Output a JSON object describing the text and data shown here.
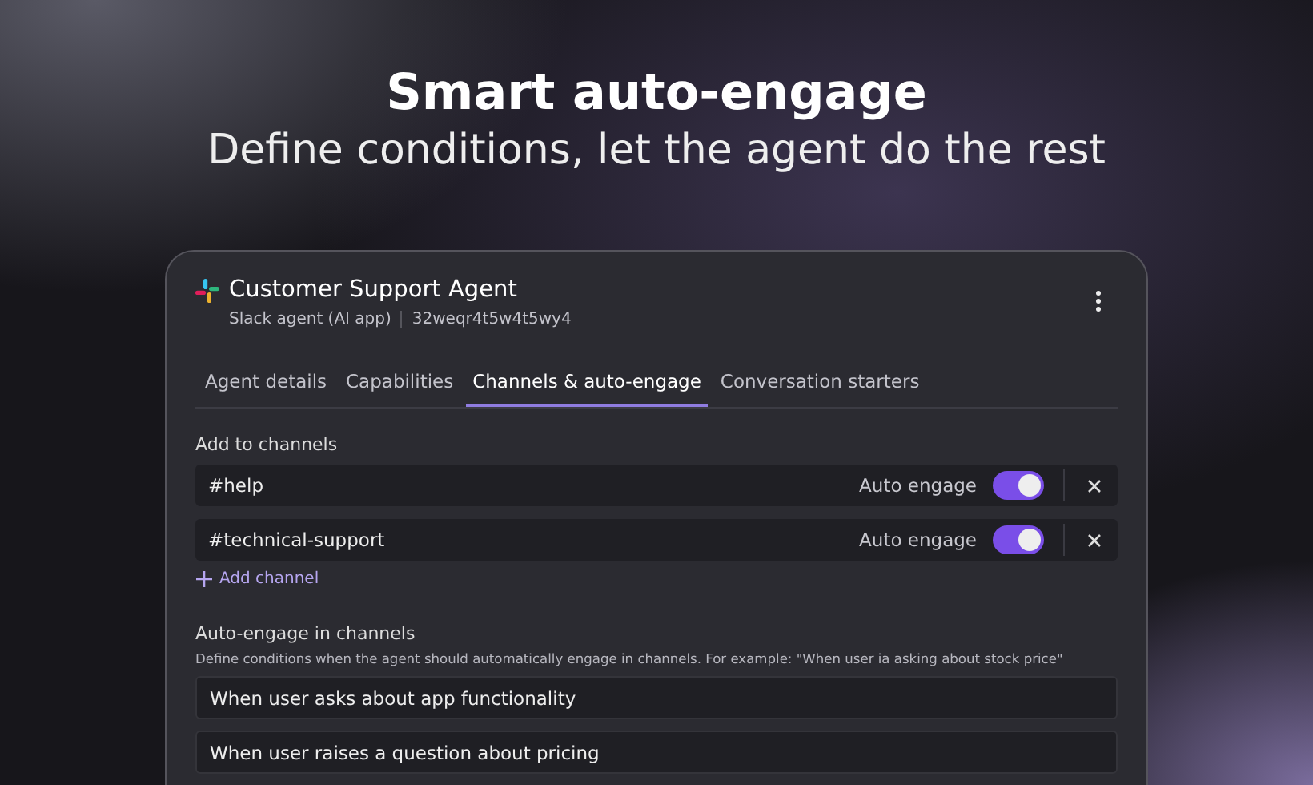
{
  "hero": {
    "title": "Smart auto-engage",
    "subtitle": "Define conditions, let the agent do the rest"
  },
  "agent": {
    "name": "Customer Support Agent",
    "type": "Slack agent (AI app)",
    "id": "32weqr4t5w4t5wy4"
  },
  "tabs": [
    {
      "label": "Agent details",
      "selected": false
    },
    {
      "label": "Capabilities",
      "selected": false
    },
    {
      "label": "Channels & auto-engage",
      "selected": true
    },
    {
      "label": "Conversation starters",
      "selected": false
    }
  ],
  "channels_section": {
    "heading": "Add to channels",
    "add_label": "Add channel"
  },
  "channels": [
    {
      "name": "#help",
      "toggle_label": "Auto engage",
      "on": true
    },
    {
      "name": "#technical-support",
      "toggle_label": "Auto engage",
      "on": true
    }
  ],
  "auto_engage": {
    "heading": "Auto-engage in channels",
    "description": "Define conditions when the agent should automatically engage in channels. For example: \"When user ia asking about stock price\"",
    "conditions": [
      "When user asks about app functionality",
      "When user raises a question about pricing"
    ]
  }
}
